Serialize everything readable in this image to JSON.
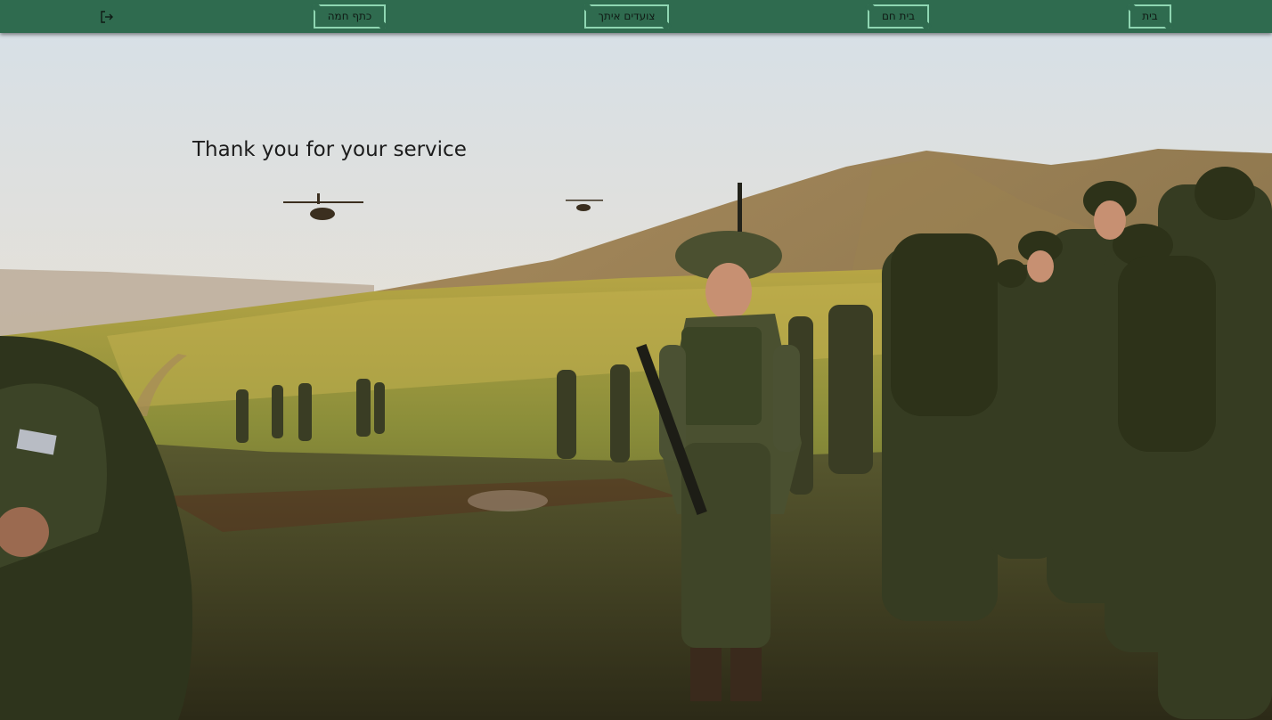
{
  "navbar": {
    "background_color": "#2f6b4f",
    "button_border_color": "#8fd6b2",
    "items": [
      {
        "label": "בית"
      },
      {
        "label": "בית חם"
      },
      {
        "label": "צועדים איתך"
      },
      {
        "label": "כתף חמה"
      }
    ],
    "logout_icon": "logout-icon"
  },
  "hero": {
    "title": "Thank you for your service",
    "image": "soldiers-in-field-photo"
  }
}
